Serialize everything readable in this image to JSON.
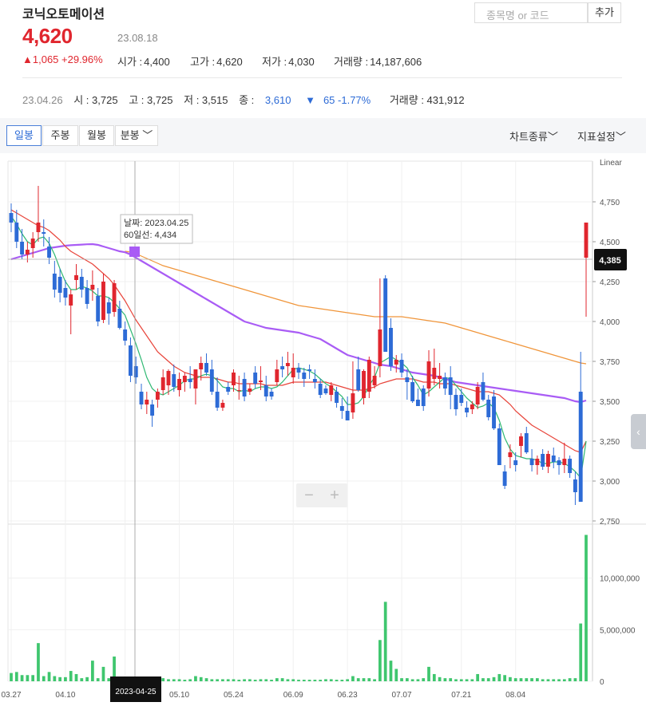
{
  "header": {
    "name": "코닉오토메이션",
    "price": "4,620",
    "date": "23.08.18",
    "change": "1,065 +29.96%",
    "open_label": "시가 :",
    "open": "4,400",
    "high_label": "고가 :",
    "high": "4,620",
    "low_label": "저가 :",
    "low": "4,030",
    "vol_label": "거래량 :",
    "vol": "14,187,606"
  },
  "search": {
    "placeholder": "종목명 or 코드",
    "add_label": "추가"
  },
  "history": {
    "date": "23.04.26",
    "open": "시 : 3,725",
    "high": "고 : 3,725",
    "low": "저 : 3,515",
    "close_label": "종 :",
    "close": "3,610",
    "change": "65 -1.77%",
    "vol": "거래량 : 431,912"
  },
  "toolbar": {
    "tabs": [
      "일봉",
      "주봉",
      "월봉",
      "분봉"
    ],
    "chart_type": "차트종류",
    "indicator": "지표설정"
  },
  "tooltip": {
    "date": "날짜: 2023.04.25",
    "ma60": "60일선: 4,434"
  },
  "current_price_tag": "4,385",
  "axis_date_tag": "2023-04-25",
  "scale_label": "Linear",
  "colors": {
    "up": "#e0262e",
    "down": "#2d6bd6",
    "ma5": "#2eb872",
    "ma20": "#e8443a",
    "ma60": "#a95cf5",
    "ma120": "#f0953a",
    "volume": "#3fc66e"
  },
  "chart_data": [
    {
      "type": "candlestick",
      "y_ticks": [
        "4,750",
        "4,500",
        "4,250",
        "4,000",
        "3,750",
        "3,500",
        "3,250",
        "3,000",
        "2,750"
      ],
      "ylim": [
        2750,
        5000
      ],
      "x_ticks": [
        "03.27",
        "04.10",
        "04.25",
        "05.10",
        "05.24",
        "06.09",
        "06.23",
        "07.07",
        "07.21",
        "08.04"
      ],
      "candles": [
        [
          4680,
          4740,
          4560,
          4620
        ],
        [
          4620,
          4700,
          4460,
          4500
        ],
        [
          4500,
          4580,
          4390,
          4420
        ],
        [
          4420,
          4500,
          4370,
          4450
        ],
        [
          4460,
          4560,
          4400,
          4520
        ],
        [
          4560,
          4850,
          4500,
          4620
        ],
        [
          4560,
          4640,
          4470,
          4550
        ],
        [
          4470,
          4530,
          4360,
          4400
        ],
        [
          4300,
          4380,
          4150,
          4200
        ],
        [
          4280,
          4330,
          4120,
          4180
        ],
        [
          4210,
          4260,
          4100,
          4150
        ],
        [
          4100,
          4200,
          3920,
          4170
        ],
        [
          4260,
          4360,
          4200,
          4290
        ],
        [
          4280,
          4330,
          4150,
          4200
        ],
        [
          4210,
          4260,
          4080,
          4110
        ],
        [
          4200,
          4320,
          4130,
          4230
        ],
        [
          4160,
          4210,
          3970,
          4000
        ],
        [
          4010,
          4300,
          3990,
          4250
        ],
        [
          4120,
          4150,
          3980,
          4050
        ],
        [
          4060,
          4260,
          4030,
          4240
        ],
        [
          4080,
          4130,
          3950,
          3960
        ],
        [
          3950,
          4000,
          3850,
          3880
        ],
        [
          3850,
          3900,
          3620,
          3660
        ],
        [
          3720,
          3780,
          3610,
          3650
        ],
        [
          3560,
          3610,
          3450,
          3480
        ],
        [
          3480,
          3560,
          3420,
          3510
        ],
        [
          3480,
          3510,
          3340,
          3410
        ],
        [
          3510,
          3580,
          3460,
          3560
        ],
        [
          3570,
          3700,
          3540,
          3650
        ],
        [
          3600,
          3700,
          3540,
          3690
        ],
        [
          3670,
          3730,
          3560,
          3590
        ],
        [
          3570,
          3680,
          3530,
          3640
        ],
        [
          3620,
          3680,
          3560,
          3660
        ],
        [
          3640,
          3720,
          3580,
          3620
        ],
        [
          3580,
          3700,
          3480,
          3700
        ],
        [
          3700,
          3780,
          3630,
          3740
        ],
        [
          3740,
          3800,
          3660,
          3680
        ],
        [
          3700,
          3760,
          3540,
          3560
        ],
        [
          3560,
          3650,
          3440,
          3460
        ],
        [
          3460,
          3510,
          3440,
          3490
        ],
        [
          3590,
          3620,
          3540,
          3560
        ],
        [
          3600,
          3700,
          3560,
          3680
        ],
        [
          3570,
          3660,
          3510,
          3570
        ],
        [
          3640,
          3680,
          3500,
          3530
        ],
        [
          3560,
          3610,
          3540,
          3580
        ],
        [
          3680,
          3720,
          3580,
          3610
        ],
        [
          3620,
          3720,
          3570,
          3630
        ],
        [
          3600,
          3660,
          3500,
          3530
        ],
        [
          3560,
          3580,
          3510,
          3530
        ],
        [
          3620,
          3760,
          3600,
          3700
        ],
        [
          3720,
          3780,
          3650,
          3700
        ],
        [
          3720,
          3810,
          3660,
          3740
        ],
        [
          3650,
          3800,
          3610,
          3710
        ],
        [
          3710,
          3740,
          3640,
          3680
        ],
        [
          3680,
          3710,
          3590,
          3640
        ],
        [
          3700,
          3730,
          3640,
          3690
        ],
        [
          3640,
          3700,
          3580,
          3620
        ],
        [
          3610,
          3640,
          3520,
          3540
        ],
        [
          3580,
          3600,
          3540,
          3550
        ],
        [
          3540,
          3620,
          3500,
          3600
        ],
        [
          3560,
          3590,
          3460,
          3490
        ],
        [
          3470,
          3520,
          3390,
          3440
        ],
        [
          3440,
          3530,
          3380,
          3380
        ],
        [
          3430,
          3750,
          3390,
          3550
        ],
        [
          3700,
          3780,
          3560,
          3570
        ],
        [
          3520,
          3700,
          3480,
          3690
        ],
        [
          3560,
          3780,
          3520,
          3760
        ],
        [
          3600,
          3720,
          3580,
          3660
        ],
        [
          3720,
          4270,
          3650,
          3950
        ],
        [
          4270,
          4290,
          3810,
          3810
        ],
        [
          3960,
          4020,
          3690,
          3720
        ],
        [
          3730,
          3790,
          3680,
          3760
        ],
        [
          3760,
          3800,
          3650,
          3680
        ],
        [
          3650,
          3700,
          3510,
          3620
        ],
        [
          3620,
          3660,
          3490,
          3500
        ],
        [
          3510,
          3580,
          3470,
          3470
        ],
        [
          3580,
          3600,
          3440,
          3470
        ],
        [
          3580,
          3820,
          3530,
          3750
        ],
        [
          3640,
          3830,
          3600,
          3710
        ],
        [
          3640,
          3740,
          3580,
          3660
        ],
        [
          3650,
          3680,
          3540,
          3580
        ],
        [
          3650,
          3720,
          3450,
          3540
        ],
        [
          3540,
          3580,
          3410,
          3450
        ],
        [
          3540,
          3580,
          3470,
          3490
        ],
        [
          3460,
          3500,
          3400,
          3430
        ],
        [
          3450,
          3500,
          3420,
          3480
        ],
        [
          3480,
          3620,
          3450,
          3590
        ],
        [
          3620,
          3680,
          3500,
          3510
        ],
        [
          3510,
          3540,
          3380,
          3400
        ],
        [
          3530,
          3570,
          3320,
          3330
        ],
        [
          3330,
          3360,
          3130,
          3100
        ],
        [
          3060,
          3100,
          2950,
          2970
        ],
        [
          3150,
          3230,
          3080,
          3180
        ],
        [
          3130,
          3180,
          3060,
          3100
        ],
        [
          3220,
          3300,
          3150,
          3280
        ],
        [
          3300,
          3340,
          3170,
          3180
        ],
        [
          3140,
          3200,
          3060,
          3100
        ],
        [
          3100,
          3160,
          3040,
          3140
        ],
        [
          3170,
          3200,
          3070,
          3090
        ],
        [
          3090,
          3190,
          3050,
          3170
        ],
        [
          3160,
          3210,
          3080,
          3120
        ],
        [
          3130,
          3150,
          3040,
          3100
        ],
        [
          3100,
          3240,
          3050,
          3140
        ],
        [
          3140,
          3160,
          3020,
          3050
        ],
        [
          3010,
          3060,
          2850,
          2930
        ],
        [
          3560,
          3810,
          2870,
          2870
        ],
        [
          4400,
          4620,
          4030,
          4620
        ]
      ],
      "ma5": [
        4660,
        4610,
        4550,
        4500,
        4480,
        4520,
        4530,
        4490,
        4420,
        4330,
        4250,
        4200,
        4200,
        4220,
        4210,
        4190,
        4160,
        4160,
        4150,
        4120,
        4080,
        4040,
        3950,
        3860,
        3760,
        3650,
        3580,
        3550,
        3540,
        3560,
        3580,
        3600,
        3630,
        3640,
        3640,
        3660,
        3670,
        3660,
        3630,
        3590,
        3580,
        3580,
        3560,
        3570,
        3560,
        3580,
        3590,
        3590,
        3580,
        3590,
        3620,
        3660,
        3700,
        3710,
        3700,
        3690,
        3670,
        3640,
        3610,
        3590,
        3560,
        3530,
        3480,
        3480,
        3490,
        3530,
        3600,
        3650,
        3740,
        3760,
        3780,
        3760,
        3740,
        3710,
        3650,
        3600,
        3540,
        3560,
        3590,
        3620,
        3650,
        3640,
        3600,
        3560,
        3520,
        3490,
        3460,
        3470,
        3490,
        3460,
        3380,
        3270,
        3200,
        3160,
        3150,
        3140,
        3140,
        3130,
        3110,
        3110,
        3120,
        3120,
        3110,
        3090,
        3060,
        3020,
        3250
      ],
      "ma20": [
        4700,
        4680,
        4660,
        4640,
        4620,
        4600,
        4590,
        4570,
        4540,
        4510,
        4470,
        4440,
        4420,
        4400,
        4380,
        4360,
        4330,
        4300,
        4270,
        4230,
        4180,
        4130,
        4070,
        4010,
        3960,
        3910,
        3860,
        3810,
        3780,
        3750,
        3720,
        3700,
        3680,
        3670,
        3660,
        3650,
        3650,
        3650,
        3640,
        3630,
        3620,
        3620,
        3610,
        3610,
        3610,
        3610,
        3610,
        3600,
        3600,
        3600,
        3600,
        3610,
        3620,
        3620,
        3620,
        3620,
        3620,
        3620,
        3620,
        3610,
        3600,
        3590,
        3580,
        3570,
        3570,
        3570,
        3580,
        3590,
        3610,
        3620,
        3630,
        3640,
        3640,
        3640,
        3640,
        3630,
        3620,
        3620,
        3620,
        3610,
        3610,
        3610,
        3600,
        3590,
        3580,
        3570,
        3560,
        3560,
        3560,
        3550,
        3540,
        3510,
        3480,
        3440,
        3410,
        3380,
        3350,
        3330,
        3310,
        3290,
        3270,
        3250,
        3230,
        3210,
        3190,
        3180,
        3250
      ],
      "ma60": [
        4390,
        4400,
        4410,
        4420,
        4430,
        4440,
        4450,
        4460,
        4465,
        4470,
        4475,
        4478,
        4480,
        4482,
        4484,
        4485,
        4480,
        4470,
        4460,
        4450,
        4440,
        4434,
        4420,
        4400,
        4380,
        4360,
        4340,
        4320,
        4300,
        4280,
        4260,
        4240,
        4220,
        4200,
        4180,
        4160,
        4140,
        4120,
        4100,
        4080,
        4060,
        4040,
        4020,
        4000,
        3990,
        3980,
        3970,
        3960,
        3955,
        3950,
        3945,
        3940,
        3935,
        3930,
        3920,
        3910,
        3900,
        3890,
        3870,
        3850,
        3830,
        3810,
        3790,
        3780,
        3770,
        3760,
        3750,
        3740,
        3730,
        3725,
        3720,
        3710,
        3700,
        3690,
        3680,
        3675,
        3670,
        3665,
        3660,
        3650,
        3640,
        3630,
        3620,
        3615,
        3610,
        3605,
        3600,
        3595,
        3590,
        3585,
        3580,
        3575,
        3570,
        3565,
        3560,
        3555,
        3550,
        3545,
        3540,
        3535,
        3530,
        3525,
        3520,
        3510,
        3500,
        3495,
        3505
      ],
      "ma120": [
        null,
        null,
        null,
        null,
        null,
        null,
        null,
        null,
        null,
        null,
        null,
        null,
        null,
        null,
        null,
        null,
        null,
        null,
        null,
        null,
        null,
        4440,
        4435,
        4425,
        4410,
        4395,
        4380,
        4365,
        4350,
        4340,
        4330,
        4320,
        4310,
        4300,
        4290,
        4280,
        4270,
        4260,
        4250,
        4240,
        4230,
        4220,
        4210,
        4200,
        4190,
        4180,
        4170,
        4160,
        4150,
        4140,
        4130,
        4120,
        4110,
        4100,
        4095,
        4090,
        4085,
        4080,
        4075,
        4070,
        4065,
        4060,
        4055,
        4050,
        4045,
        4040,
        4035,
        4030,
        4030,
        4030,
        4030,
        4030,
        4030,
        4025,
        4020,
        4015,
        4010,
        4005,
        4000,
        3995,
        3990,
        3980,
        3970,
        3960,
        3950,
        3940,
        3930,
        3920,
        3910,
        3900,
        3890,
        3880,
        3870,
        3860,
        3850,
        3840,
        3830,
        3820,
        3810,
        3800,
        3790,
        3780,
        3770,
        3760,
        3750,
        3740,
        3735
      ]
    },
    {
      "type": "bar",
      "y_ticks": [
        "10,000,000",
        "5,000,000",
        "0"
      ],
      "ylim": [
        0,
        15000000
      ],
      "volumes": [
        800000,
        900000,
        600000,
        600000,
        600000,
        3700000,
        500000,
        900000,
        500000,
        400000,
        400000,
        1000000,
        700000,
        300000,
        400000,
        2000000,
        300000,
        1400000,
        300000,
        2400000,
        200000,
        200000,
        300000,
        300000,
        200000,
        200000,
        150000,
        150000,
        300000,
        200000,
        200000,
        200000,
        150000,
        200000,
        500000,
        400000,
        300000,
        200000,
        200000,
        200000,
        200000,
        200000,
        150000,
        200000,
        200000,
        150000,
        200000,
        200000,
        150000,
        300000,
        300000,
        200000,
        200000,
        150000,
        150000,
        150000,
        150000,
        150000,
        200000,
        200000,
        150000,
        150000,
        200000,
        500000,
        300000,
        300000,
        300000,
        200000,
        4000000,
        7700000,
        2000000,
        1200000,
        300000,
        300000,
        200000,
        200000,
        300000,
        1400000,
        700000,
        400000,
        300000,
        300000,
        200000,
        200000,
        200000,
        200000,
        700000,
        300000,
        300000,
        400000,
        700000,
        600000,
        400000,
        300000,
        300000,
        300000,
        300000,
        300000,
        200000,
        200000,
        200000,
        200000,
        200000,
        300000,
        300000,
        5600000,
        14187606
      ]
    }
  ]
}
